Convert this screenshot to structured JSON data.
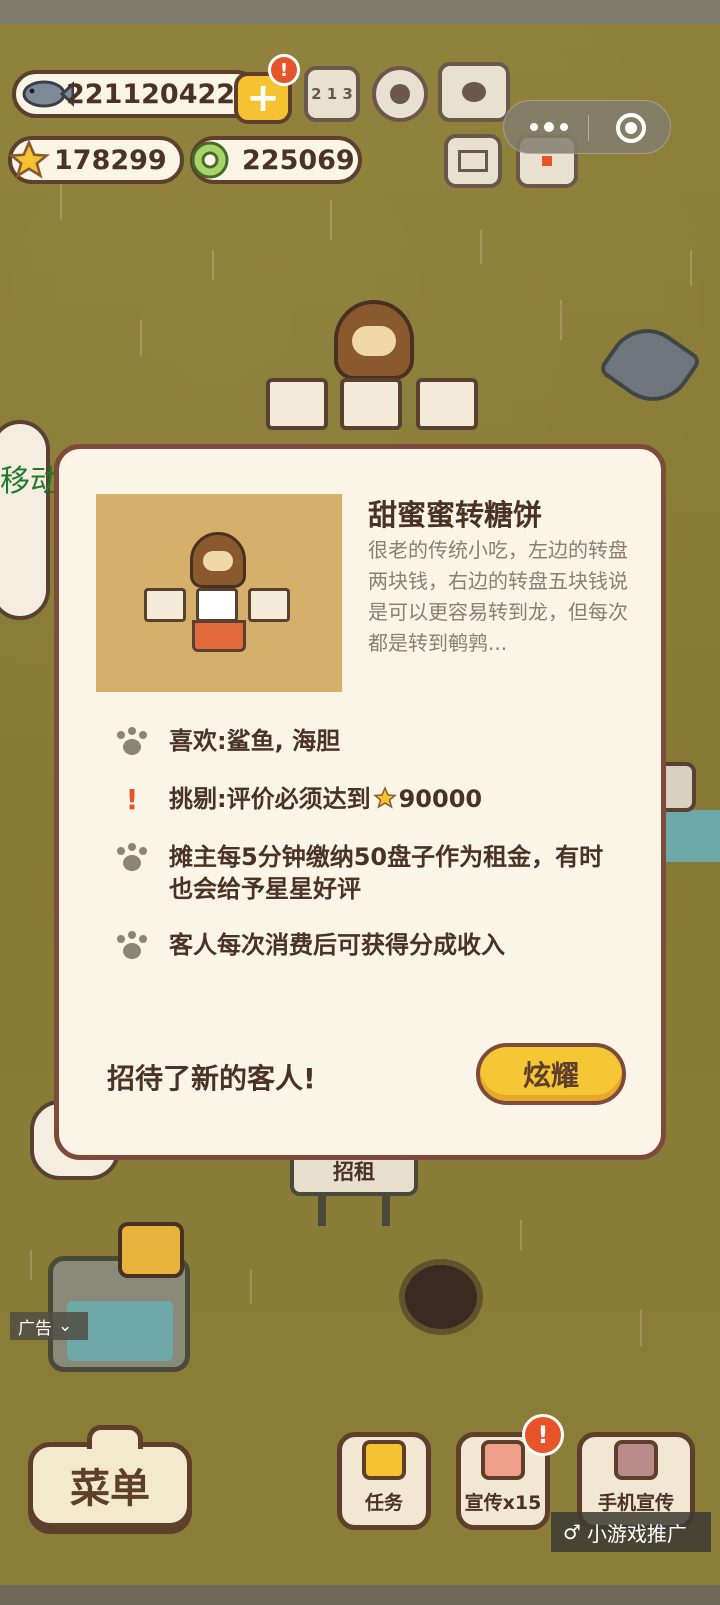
{
  "currency": {
    "fish": "221120422",
    "star": "178299",
    "ring": "225069"
  },
  "top_icons": {
    "alert_badge": "!",
    "ranking_label": "2 1 3"
  },
  "background": {
    "side_text": "移动",
    "rent_sign": "招租",
    "ad_label": "广告",
    "ad_chevron": "⌄"
  },
  "modal": {
    "title": "甜蜜蜜转糖饼",
    "description": "很老的传统小吃，左边的转盘两块钱，右边的转盘五块钱说是可以更容易转到龙，但每次都是转到鹌鹑...",
    "rules": [
      {
        "icon": "paw-icon",
        "text": "喜欢:鲨鱼, 海胆"
      },
      {
        "icon": "exclamation-icon",
        "text_before": "挑剔:评价必须达到",
        "text_after": "90000"
      },
      {
        "icon": "paw-icon",
        "text": "摊主每5分钟缴纳50盘子作为租金，有时也会给予星星好评"
      },
      {
        "icon": "paw-icon",
        "text": "客人每次消费后可获得分成收入"
      }
    ],
    "exclamation_glyph": "!",
    "footer_text": "招待了新的客人!",
    "show_button": "炫耀"
  },
  "bottom": {
    "menu_label": "菜单",
    "task_label": "任务",
    "promote_label": "宣传x15",
    "phone_promote_label": "手机宣传",
    "promote_badge": "!",
    "promo_tag": "小游戏推广",
    "promo_tag_icon": "♂"
  },
  "colors": {
    "background": "#8a7d3a",
    "modal_border": "#7e4a3c",
    "button_yellow": "#f6c735",
    "alert_red": "#e8542a"
  }
}
